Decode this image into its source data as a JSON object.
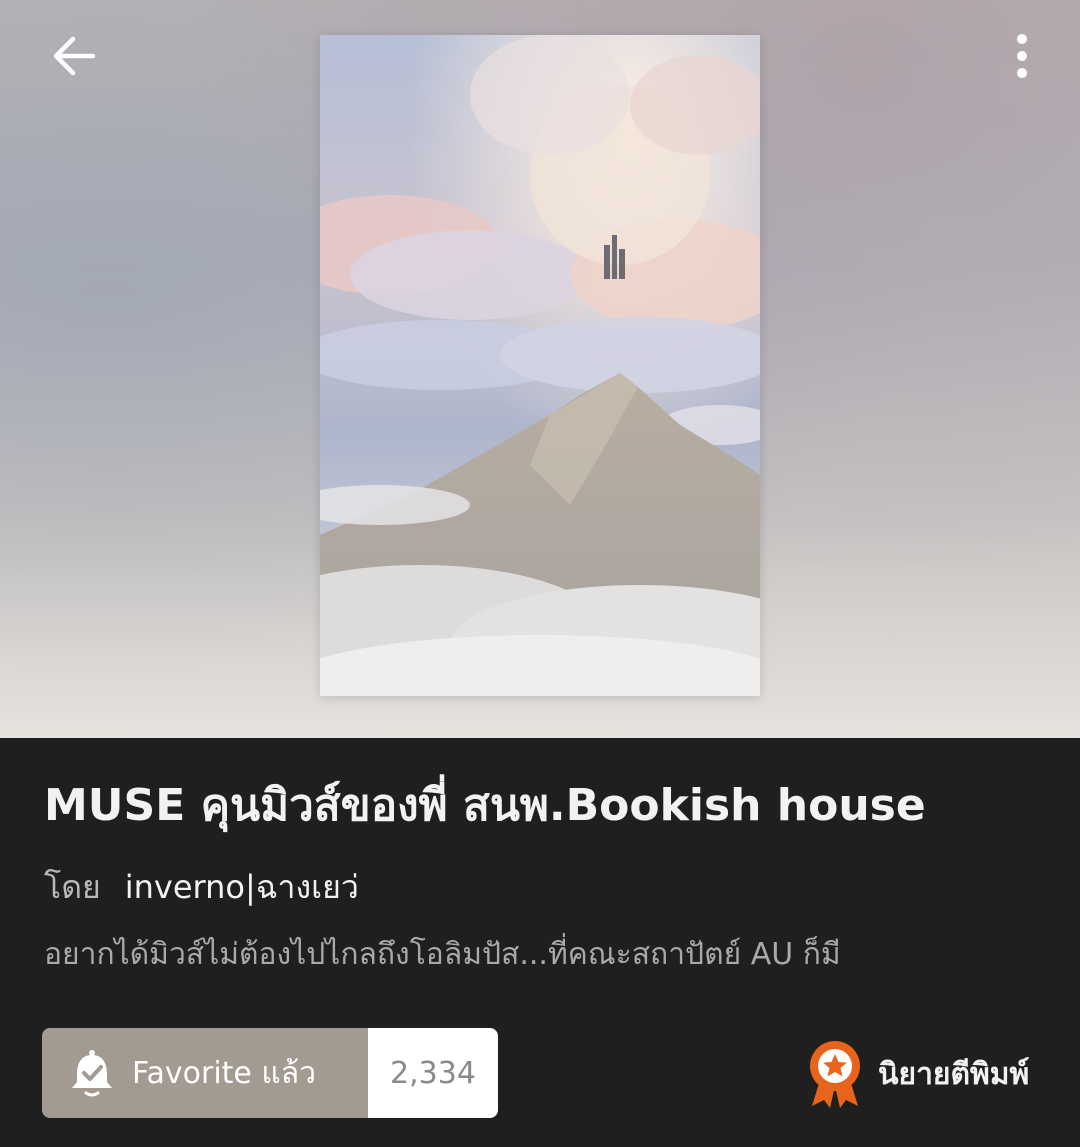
{
  "toolbar": {
    "back_icon": "arrow-left-icon",
    "more_icon": "more-vertical-icon"
  },
  "novel": {
    "title": "MUSE คุนมิวส์ของพี่ สนพ.Bookish house",
    "author_prefix": "โดย",
    "author_name": "inverno|ฉางเยว่",
    "description": "อยากได้มิวส์ไม่ต้องไปไกลถึงโอลิมปัส...ที่คณะสถาปัตย์ AU ก็มี"
  },
  "favorite": {
    "icon": "bell-check-icon",
    "label": "Favorite แล้ว",
    "count": "2,334",
    "colors": {
      "button_bg": "#a39a92",
      "count_bg": "#ffffff"
    }
  },
  "badge": {
    "icon": "award-ribbon-icon",
    "label": "นิยายตีพิมพ์",
    "color": "#e8641c"
  }
}
